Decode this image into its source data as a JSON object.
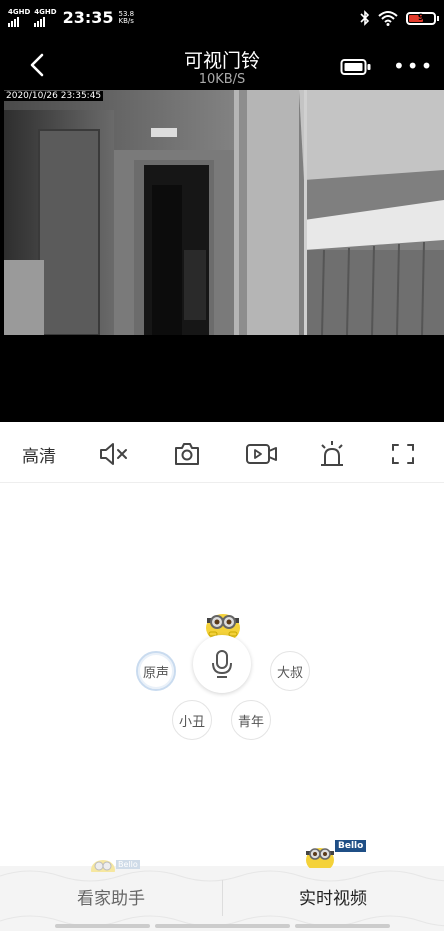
{
  "status_bar": {
    "network_1": "4GHD",
    "network_2": "4GHD",
    "time": "23:35",
    "speed_value": "53.8",
    "speed_unit": "KB/s",
    "battery": "9",
    "icons": [
      "bluetooth-icon",
      "wifi-icon",
      "battery-icon"
    ]
  },
  "nav": {
    "title": "可视门铃",
    "subtitle": "10KB/S",
    "icons": [
      "back-icon",
      "device-battery-icon",
      "more-icon"
    ]
  },
  "video": {
    "timestamp": "2020/10/26 23:35:45"
  },
  "toolbar": {
    "quality_label": "高清",
    "icons": [
      "mute-icon",
      "snapshot-icon",
      "record-icon",
      "alarm-icon",
      "fullscreen-icon"
    ]
  },
  "voice": {
    "options": [
      "原声",
      "大叔",
      "小丑",
      "青年"
    ],
    "selected": "原声",
    "icons": [
      "microphone-icon",
      "minion-mascot"
    ]
  },
  "mascot_badges": [
    "Bello",
    "Bello"
  ],
  "tabs": {
    "left": "看家助手",
    "right": "实时视频",
    "active": "right"
  },
  "colors": {
    "status_bar_bg": "#000000",
    "battery_low": "#e23b2b",
    "voice_selected_ring": "#c9dbef",
    "tabbar_bg": "#f4f4f4"
  }
}
